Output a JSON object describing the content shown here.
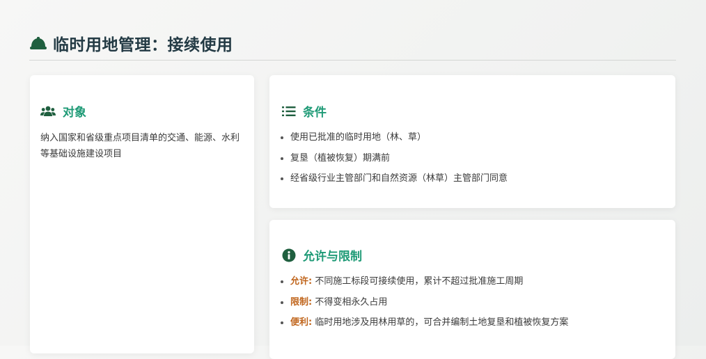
{
  "header": {
    "title": "临时用地管理：接续使用",
    "icon": "hard-hat-icon",
    "icon_color": "#1f5f3f"
  },
  "target_card": {
    "icon": "users-icon",
    "heading": "对象",
    "text": "纳入国家和省级重点项目清单的交通、能源、水利等基础设施建设项目"
  },
  "conditions_card": {
    "icon": "list-icon",
    "heading": "条件",
    "items": [
      "使用已批准的临时用地（林、草）",
      "复垦（植被恢复）期满前",
      "经省级行业主管部门和自然资源（林草）主管部门同意"
    ]
  },
  "allow_card": {
    "icon": "info-circle-icon",
    "heading": "允许与限制",
    "items": [
      {
        "label": "允许:",
        "text": "不同施工标段可接续使用，累计不超过批准施工周期"
      },
      {
        "label": "限制:",
        "text": "不得变相永久占用"
      },
      {
        "label": "便利:",
        "text": "临时用地涉及用林用草的，可合并编制土地复垦和植被恢复方案"
      }
    ]
  },
  "colors": {
    "heading_accent": "#1e9a76",
    "label_accent": "#c0651c",
    "title_text": "#233a44",
    "icon_dark": "#1f5f3f"
  }
}
